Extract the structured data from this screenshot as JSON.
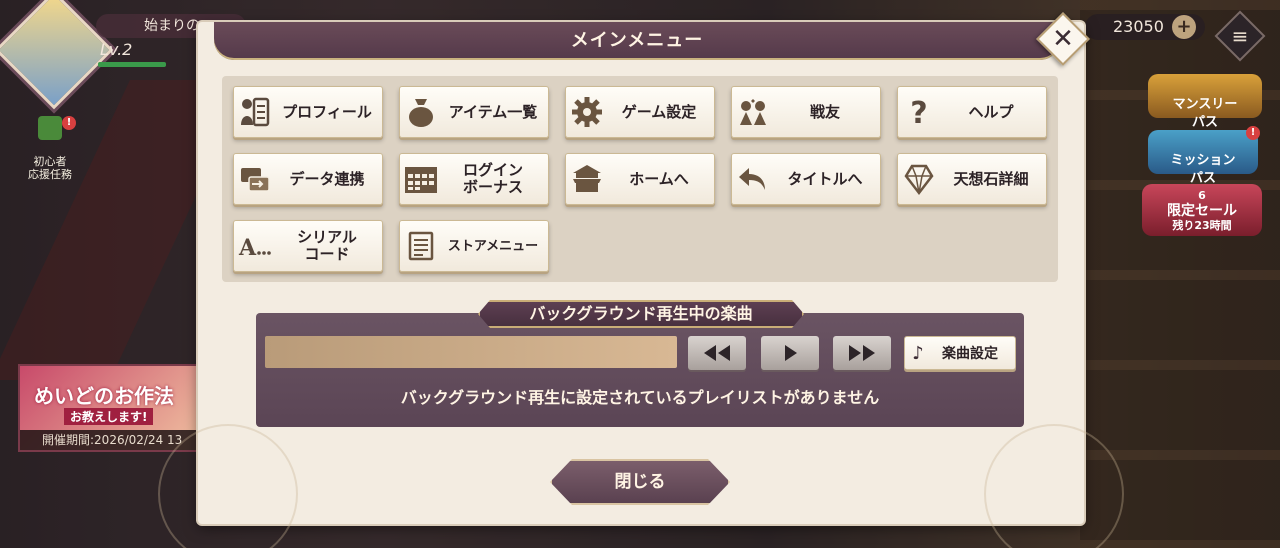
{
  "background": {
    "player_name": "始まりの",
    "level_label": "Lv.2",
    "currency_amount": "23050",
    "currency_add_symbol": "+",
    "menu_symbol": "≡",
    "beginner_mission": "初心者\n応援任務",
    "monthly_pass": "マンスリー\nパス",
    "mission_pass": "ミッション\nパス",
    "limited_sale": "限定セール",
    "limited_sale_count": "6",
    "limited_sale_remaining": "残り23時間",
    "event_banner_title": "めいどのお作法",
    "event_banner_subtitle": "お教えします!",
    "event_period": "開催期間:2026/02/24 13"
  },
  "menu": {
    "title": "メインメニュー",
    "close_symbol": "✕",
    "buttons": [
      {
        "label": "プロフィール",
        "icon": "profile-icon"
      },
      {
        "label": "アイテム一覧",
        "icon": "item-bag-icon"
      },
      {
        "label": "ゲーム設定",
        "icon": "gear-icon"
      },
      {
        "label": "戦友",
        "icon": "friends-icon"
      },
      {
        "label": "ヘルプ",
        "icon": "question-icon"
      },
      {
        "label": "データ連携",
        "icon": "data-transfer-icon"
      },
      {
        "label": "ログイン\nボーナス",
        "icon": "calendar-icon"
      },
      {
        "label": "ホームへ",
        "icon": "home-icon"
      },
      {
        "label": "タイトルへ",
        "icon": "back-arrow-icon"
      },
      {
        "label": "天想石詳細",
        "icon": "gem-icon"
      },
      {
        "label": "シリアル\nコード",
        "icon": "serial-code-icon"
      },
      {
        "label": "ストアメニュー",
        "icon": "store-menu-icon"
      }
    ]
  },
  "bgm": {
    "header": "バックグラウンド再生中の楽曲",
    "progress": 0,
    "rewind_icon": "rewind-icon",
    "play_icon": "play-icon",
    "forward_icon": "fast-forward-icon",
    "song_settings_label": "楽曲設定",
    "song_settings_symbol": "♪",
    "empty_message": "バックグラウンド再生に設定されているプレイリストがありません"
  },
  "footer": {
    "close_label": "閉じる"
  }
}
